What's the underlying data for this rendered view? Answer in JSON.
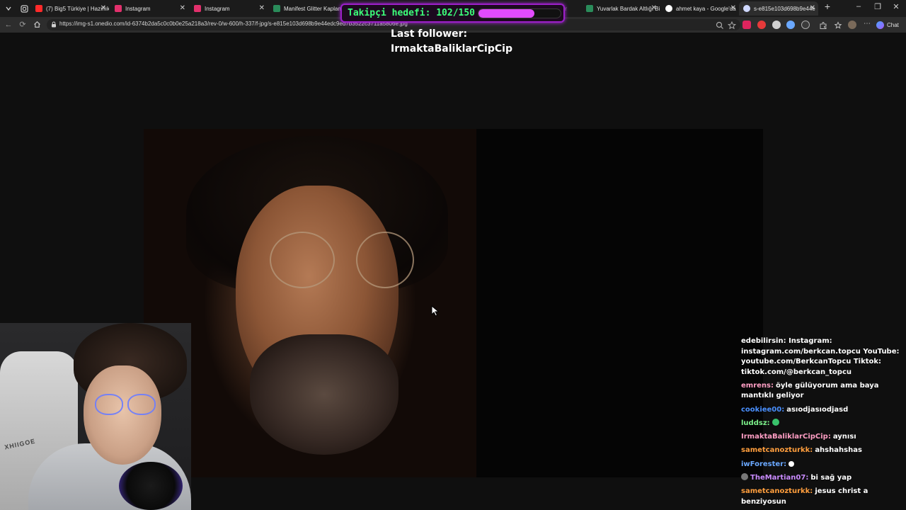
{
  "browser": {
    "tabs": [
      {
        "label": "(7) Big5 Türkiye | Hazırlık",
        "favicon_color": "#ff2a2a"
      },
      {
        "label": "Instagram",
        "favicon_color": "#e1306c"
      },
      {
        "label": "Instagram",
        "favicon_color": "#e1306c"
      },
      {
        "label": "Manifest Glitter Kaplama",
        "favicon_color": "#2a8c5a"
      },
      {
        "label": "Yuvarlak Bardak Altlığı Bi",
        "favicon_color": "#2a8c5a"
      },
      {
        "label": "ahmet kaya - Google'da",
        "favicon_color": "#ffffff"
      },
      {
        "label": "s-e815e103d698b9e44e",
        "favicon_color": "#cfd8ff",
        "active": true
      }
    ],
    "new_tab_label": "+",
    "window_controls": [
      "–",
      "❐",
      "✕"
    ],
    "url": "https://img-s1.onedio.com/id-6374b2da5c0c0b0e25a218a3/rev-0/w-600/h-337/f-jpg/s-e815e103d698b9e44edc9ed7b3522c3711a5806e.jpg",
    "chat_button_label": "Chat"
  },
  "overlay": {
    "goal_text": "Takipçi hedefi: 102/150",
    "goal_current": 102,
    "goal_target": 150,
    "goal_color": "#3cff7a",
    "goal_bar_color": "#e24bff",
    "last_follower_label": "Last follower:",
    "last_follower_name": "IrmaktaBaliklarCipCip"
  },
  "webcam": {
    "chair_brand": "XHIIGOE"
  },
  "chat": {
    "messages": [
      {
        "user": "",
        "user_color": "#ffffff",
        "text": "edebilirsin: Instagram: instagram.com/berkcan.topcu YouTube: youtube.com/BerkcanTopcu Tiktok: tiktok.com/@berkcan_topcu"
      },
      {
        "user": "emrens:",
        "user_color": "#ff9ec4",
        "text": "öyle gülüyorum ama baya mantıklı geliyor"
      },
      {
        "user": "cookiee00:",
        "user_color": "#4a90ff",
        "text": "asıodjasıodjasd"
      },
      {
        "user": "luddsz:",
        "user_color": "#7cf08a",
        "text": "",
        "emote_color": "#39c26b"
      },
      {
        "user": "IrmaktaBaliklarCipCip:",
        "user_color": "#ff9ec4",
        "text": "aynısı"
      },
      {
        "user": "sametcanozturkk:",
        "user_color": "#ff9e3d",
        "text": "ahshahshas"
      },
      {
        "user": "iwForester:",
        "user_color": "#6aa8ff",
        "text": "",
        "emote_color": "#ffffff"
      },
      {
        "user": "TheMartian07:",
        "user_color": "#c98bff",
        "text": "bi sağ yap",
        "badge_color": "#777777"
      },
      {
        "user": "sametcanozturkk:",
        "user_color": "#ff9e3d",
        "text": "jesus christ a benziyosun"
      }
    ]
  }
}
